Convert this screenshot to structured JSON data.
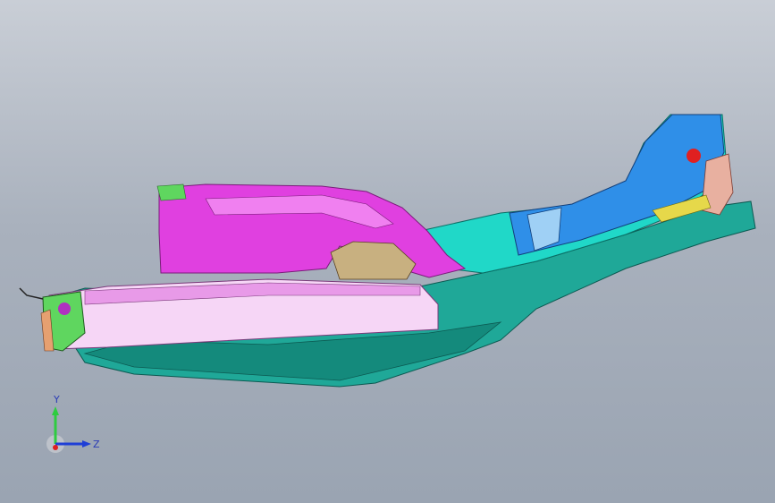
{
  "viewport": {
    "background_top": "#c9ced6",
    "background_bottom": "#9aa4b2"
  },
  "triad": {
    "y_label": "Y",
    "z_label": "Z",
    "y_color": "#2ecc40",
    "z_color": "#1f3fd6",
    "x_color": "#e02020"
  },
  "model": {
    "part_colors": {
      "magenta": "#e040e0",
      "teal": "#1fa898",
      "cyan": "#20d8c8",
      "blue": "#2f8fe8",
      "pink_white": "#f6d6f6",
      "green": "#5fd65f",
      "red": "#e02020"
    }
  }
}
